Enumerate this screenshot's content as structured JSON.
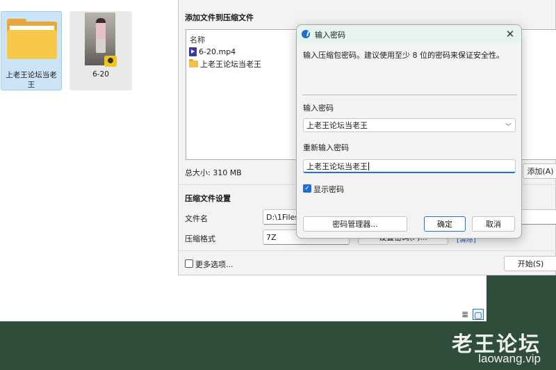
{
  "explorer": {
    "items": [
      {
        "name": "上老王论坛当老王",
        "type": "folder",
        "selected": true
      },
      {
        "name": "6-20",
        "type": "video",
        "badge": "Player"
      }
    ]
  },
  "compress": {
    "add_files_heading": "添加文件到压缩文件",
    "list_header": "名称",
    "files": [
      {
        "name": "6-20.mp4",
        "icon": "video-file-icon"
      },
      {
        "name": "上老王论坛当老王",
        "icon": "folder-icon"
      }
    ],
    "total_size": "总大小: 310 MB",
    "add_button": "添加(A)",
    "settings_heading": "压缩文件设置",
    "filename_label": "文件名",
    "filename_value": "D:\\1Files\\",
    "format_label": "压缩格式",
    "format_value": "7Z",
    "password_button": "设置密码(P)...",
    "clear_link": "[清除]",
    "more_options": "更多选项...",
    "start_button": "开始(S)"
  },
  "dialog": {
    "title": "输入密码",
    "close": "✕",
    "description": "输入压缩包密码。建议使用至少 8 位的密码来保证安全性。",
    "password_label": "输入密码",
    "password_value": "上老王论坛当老王",
    "confirm_label": "重新输入密码",
    "confirm_value": "上老王论坛当老王",
    "show_password_label": "显示密码",
    "show_password_checked": true,
    "manager_button": "密码管理器...",
    "ok_button": "确定",
    "cancel_button": "取消"
  },
  "view_toggle": {
    "details_icon": "≣",
    "tiles_icon": "▢"
  },
  "watermark": {
    "title": "老王论坛",
    "site": "laowang.vip"
  },
  "colors": {
    "accent": "#1f6fd1",
    "footer_green": "#2e4d3a",
    "selection": "#cce4f7"
  }
}
